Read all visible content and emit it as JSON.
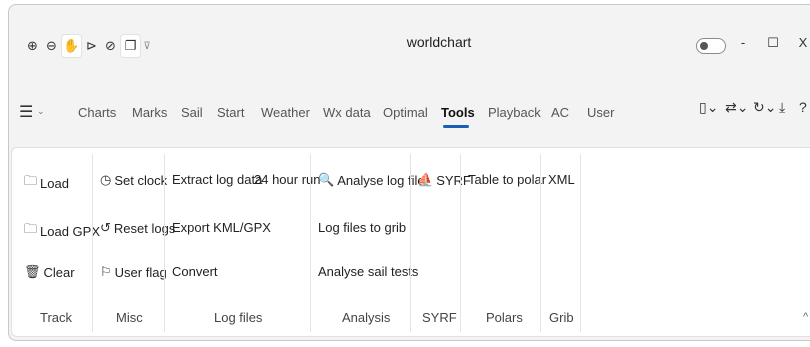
{
  "window": {
    "title": "worldchart",
    "controls": {
      "minimize": "-",
      "maximize": "☐",
      "close": "X"
    }
  },
  "quick_access": {
    "zoom_in": "⊕",
    "zoom_out": "⊖",
    "pan": "✋",
    "select": "⊳",
    "measure": "⊘",
    "copy": "❐",
    "more": "⊽"
  },
  "menu": {
    "hamburger": "☰",
    "hamburger_chevron": "⌄",
    "tabs": [
      "Charts",
      "Marks",
      "Sail",
      "Start",
      "Weather",
      "Wx data",
      "Optimal",
      "Tools",
      "Playback",
      "AC",
      "User"
    ],
    "active_tab": "Tools",
    "right_icons": {
      "device": "▯⌄",
      "sliders": "⇄⌄",
      "rotate": "↻⌄",
      "download": "⤓",
      "help": "?"
    }
  },
  "ribbon": {
    "track": {
      "label": "Track",
      "load": "Load",
      "load_gpx": "Load GPX",
      "clear": "Clear"
    },
    "misc": {
      "label": "Misc",
      "set_clock": "Set clock",
      "reset_logs": "Reset logs",
      "user_flag": "User flag"
    },
    "log_files": {
      "label": "Log files",
      "extract": "Extract log data",
      "run24": "24 hour run",
      "export": "Export KML/GPX",
      "convert": "Convert"
    },
    "analysis": {
      "label": "Analysis",
      "analyse": "Analyse log file",
      "to_grib": "Log files to grib",
      "sail_tests": "Analyse sail tests"
    },
    "syrf": {
      "label": "SYRF",
      "syrf": "SYRF"
    },
    "polars": {
      "label": "Polars",
      "table_to_polar": "Table to polar"
    },
    "grib": {
      "label": "Grib",
      "xml": "XML"
    },
    "collapse": "^"
  },
  "colors": {
    "accent": "#1a5fb4"
  }
}
